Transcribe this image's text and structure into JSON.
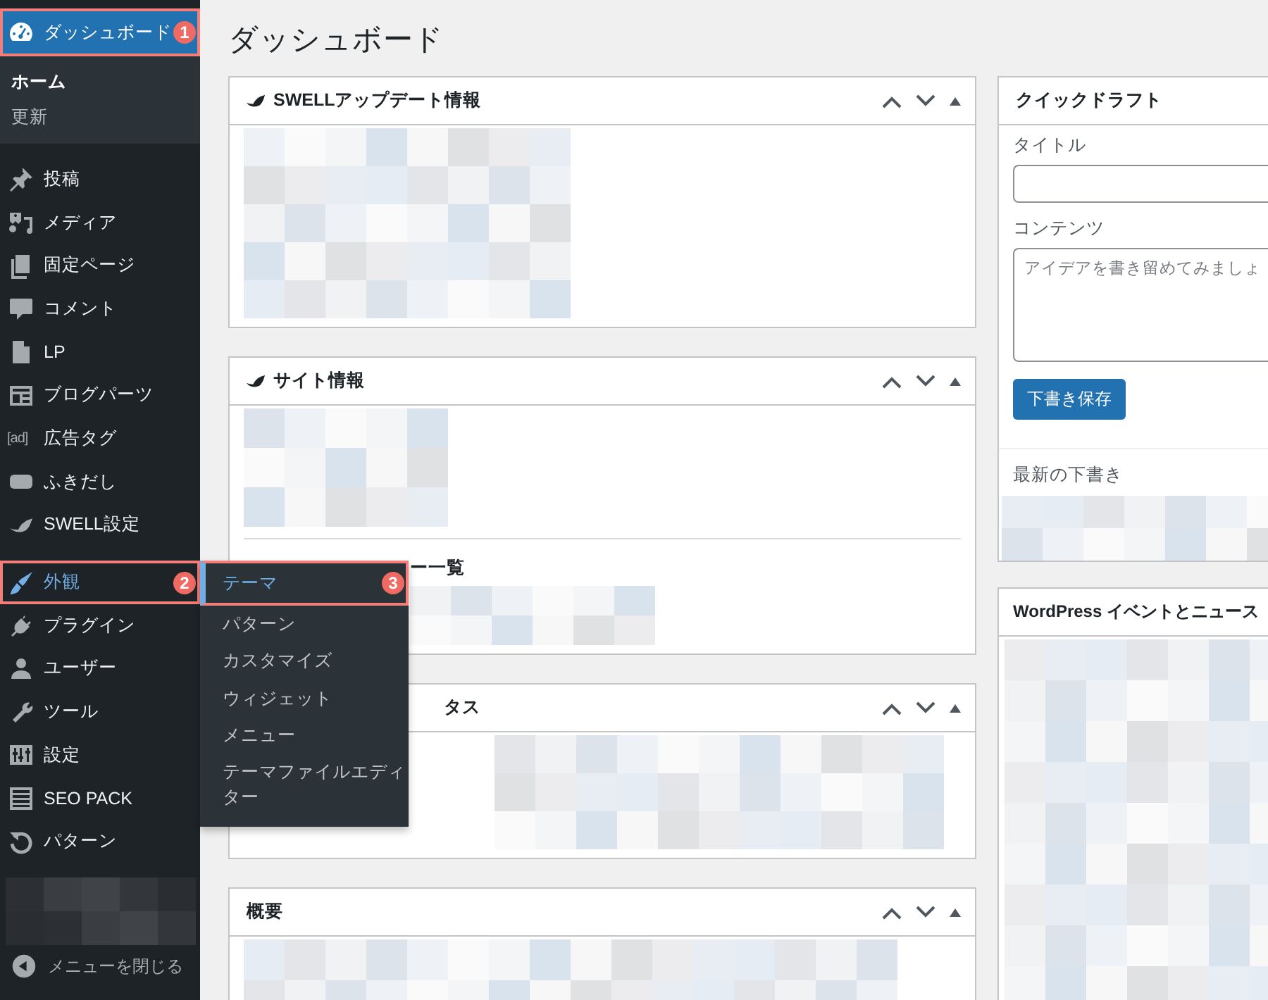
{
  "sidebar": {
    "groups": [
      [
        {
          "label": "ダッシュボード",
          "current": true,
          "open": false,
          "annotation": "1",
          "submenu": [
            {
              "label": "ホーム",
              "selected": true
            },
            {
              "label": "更新",
              "selected": false
            }
          ]
        }
      ],
      [
        {
          "label": "投稿",
          "current": false,
          "open": false
        },
        {
          "label": "メディア",
          "current": false,
          "open": false
        },
        {
          "label": "固定ページ",
          "current": false,
          "open": false
        },
        {
          "label": "コメント",
          "current": false,
          "open": false
        },
        {
          "label": "LP",
          "current": false,
          "open": false
        },
        {
          "label": "ブログパーツ",
          "current": false,
          "open": false
        },
        {
          "label": "広告タグ",
          "icon_text": "[ad]",
          "current": false,
          "open": false
        },
        {
          "label": "ふきだし",
          "current": false,
          "open": false
        },
        {
          "label": "SWELL設定",
          "current": false,
          "open": false
        }
      ],
      [
        {
          "label": "外観",
          "current": false,
          "open": true,
          "annotation": "2",
          "flyout": [
            {
              "label": "テーマ",
              "selected": true,
              "annotation": "3"
            },
            {
              "label": "パターン",
              "selected": false
            },
            {
              "label": "カスタマイズ",
              "selected": false
            },
            {
              "label": "ウィジェット",
              "selected": false
            },
            {
              "label": "メニュー",
              "selected": false
            },
            {
              "label": "テーマファイルエディター",
              "selected": false
            }
          ]
        },
        {
          "label": "プラグイン",
          "current": false,
          "open": false
        },
        {
          "label": "ユーザー",
          "current": false,
          "open": false
        },
        {
          "label": "ツール",
          "current": false,
          "open": false
        },
        {
          "label": "設定",
          "current": false,
          "open": false
        },
        {
          "label": "SEO PACK",
          "current": false,
          "open": false
        },
        {
          "label": "パターン",
          "current": false,
          "open": false
        }
      ]
    ],
    "collapse_label": "メニューを閉じる"
  },
  "page_title": "ダッシュボード",
  "left_panels": [
    {
      "title": "SWELLアップデート情報",
      "brand_icon": true,
      "title_cut": false
    },
    {
      "title": "サイト情報",
      "brand_icon": true,
      "title_cut": false,
      "subheading": "ー一覧"
    },
    {
      "title": "タス",
      "brand_icon": false,
      "title_cut": true
    },
    {
      "title": "概要",
      "brand_icon": false
    }
  ],
  "quick_draft": {
    "title": "クイックドラフト",
    "title_label": "タイトル",
    "content_label": "コンテンツ",
    "content_placeholder": "アイデアを書き留めてみましょ",
    "save_button": "下書き保存",
    "recent_heading": "最新の下書き"
  },
  "events_panel": {
    "title": "WordPress イベントとニュース"
  }
}
